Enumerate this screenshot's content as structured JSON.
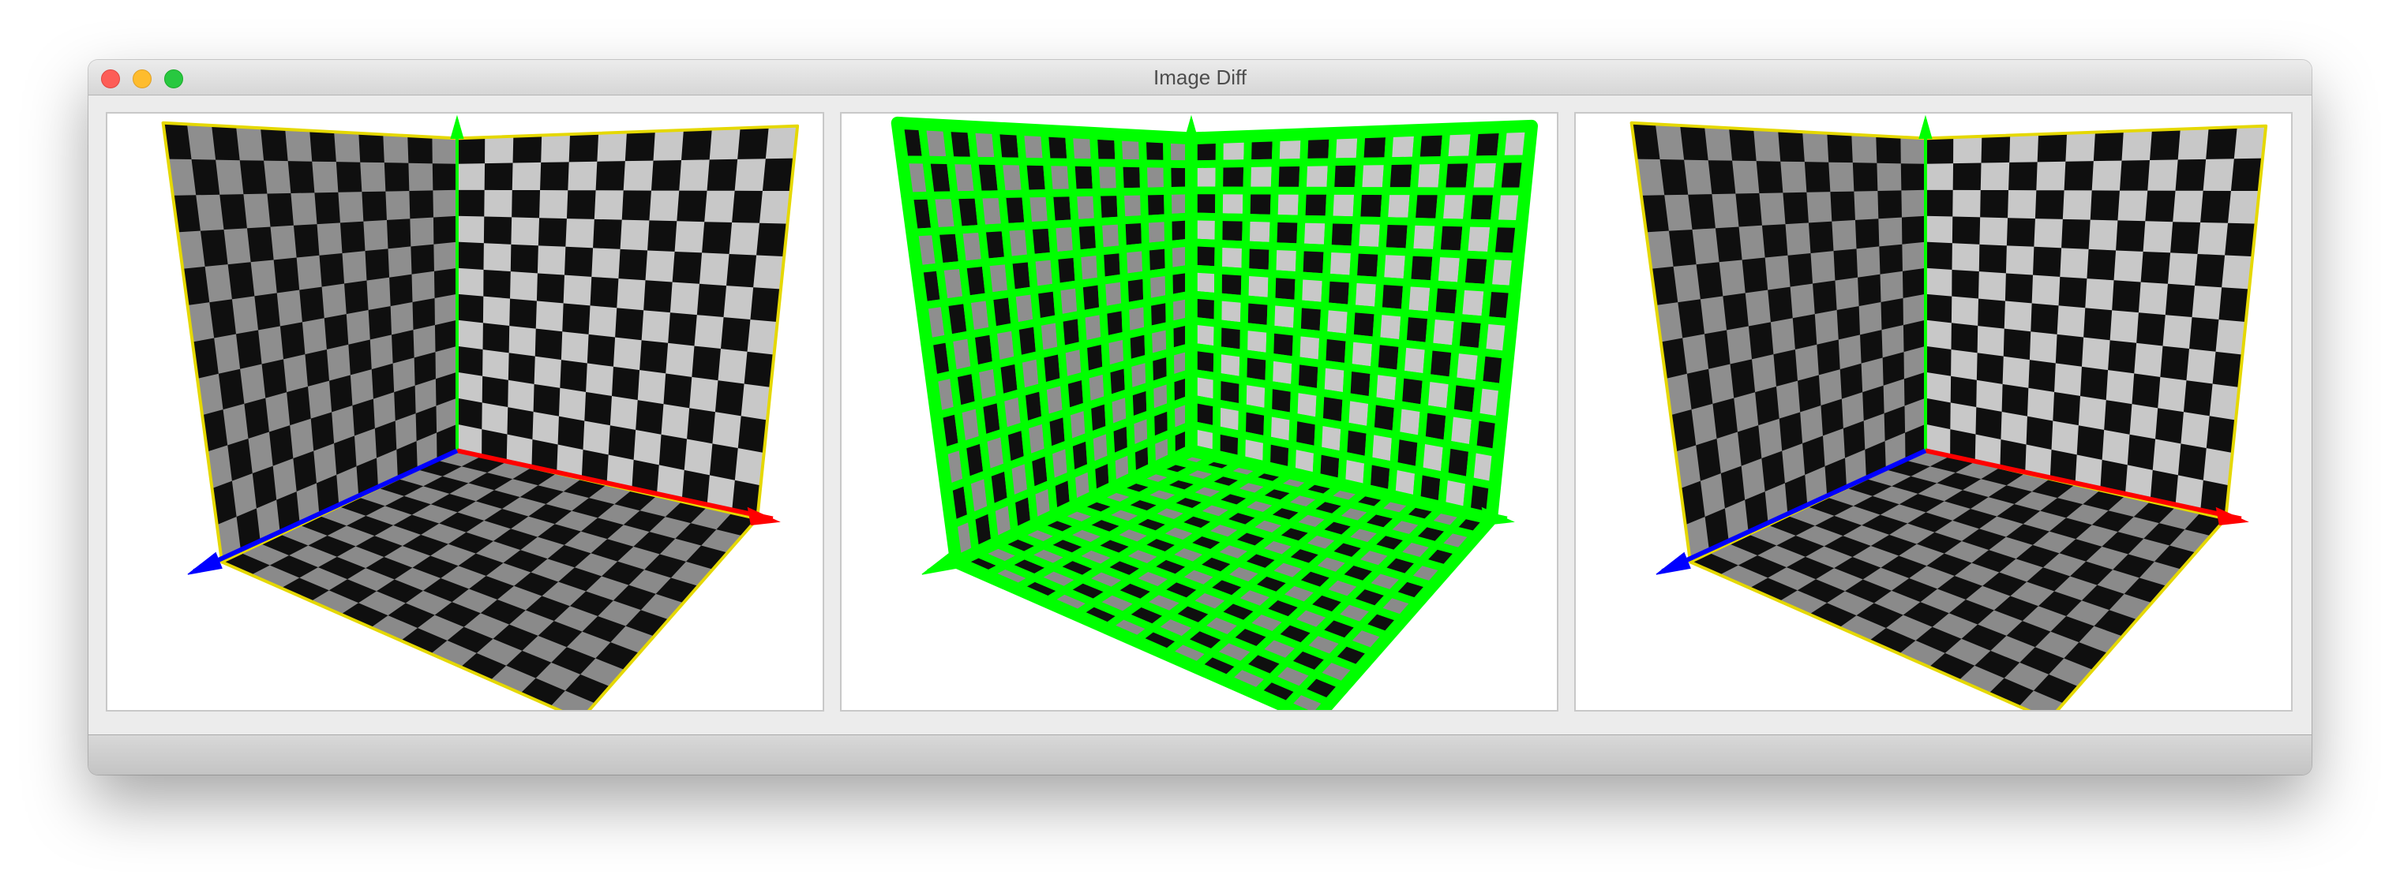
{
  "window": {
    "title": "Image Diff",
    "controls": [
      "close",
      "minimize",
      "zoom"
    ]
  },
  "panes": [
    {
      "name": "left-image",
      "mode": "render"
    },
    {
      "name": "diff-image",
      "mode": "diff",
      "highlight_color": "#00ff00"
    },
    {
      "name": "right-image",
      "mode": "render"
    }
  ],
  "colors": {
    "dark_square": "#0f0f0f",
    "wall_light_square": "#c8c8c8",
    "left_wall_light_square": "#8e8e8e",
    "floor_light_square": "#8a8a8a",
    "x_axis": "#ff0000",
    "y_axis": "#00ff00",
    "z_axis": "#0000ff",
    "edge_outline": "#e5d800",
    "diff_grid": "#00ff00"
  }
}
